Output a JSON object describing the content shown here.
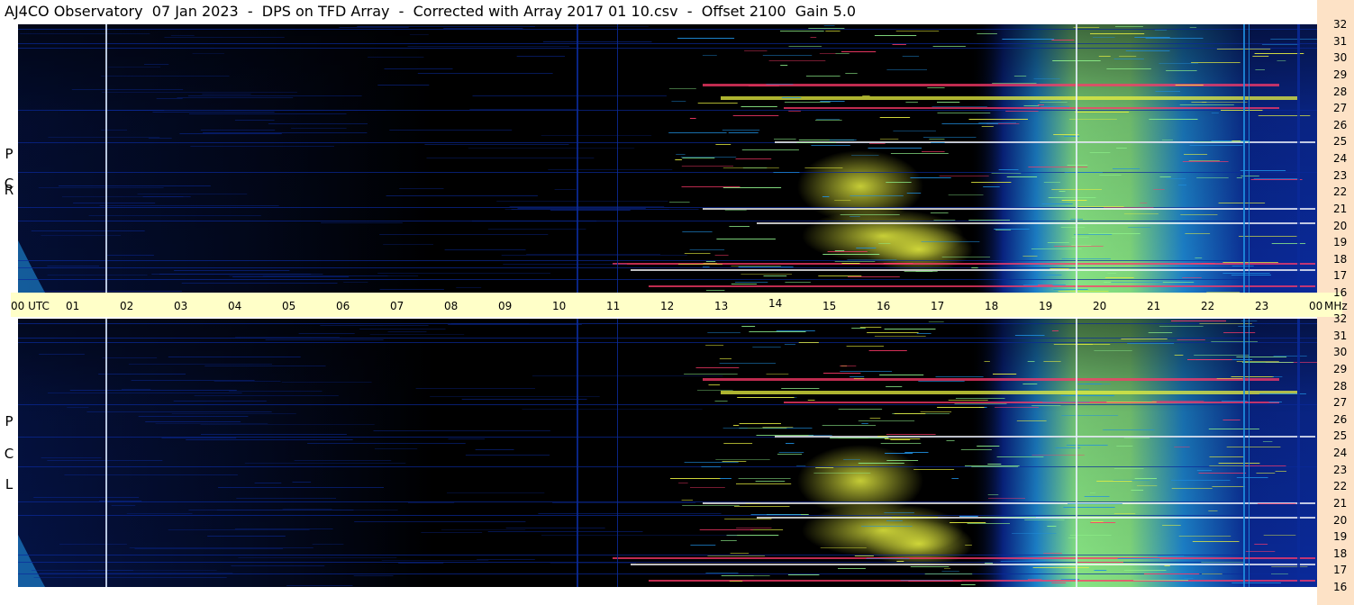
{
  "title": "AJ4CO Observatory  07 Jan 2023  -  DPS on TFD Array  -  Corrected with Array 2017 01 10.csv  -  Offset 2100  Gain 5.0",
  "chart_data": {
    "type": "heatmap",
    "title": "AJ4CO Observatory  07 Jan 2023  -  DPS on TFD Array  -  Corrected with Array 2017 01 10.csv  -  Offset 2100  Gain 5.0",
    "x_axis": {
      "unit_label": "UTC",
      "range": [
        0,
        24
      ],
      "tick_labels": [
        "00 UTC",
        "01",
        "02",
        "03",
        "04",
        "05",
        "06",
        "07",
        "08",
        "09",
        "10",
        "11",
        "12",
        "13",
        "14",
        "15",
        "16",
        "17",
        "18",
        "19",
        "20",
        "21",
        "22",
        "23",
        "00"
      ]
    },
    "y_axis": {
      "unit_label": "MHz",
      "range": [
        16,
        32
      ],
      "tick_labels": [
        "32",
        "31",
        "30",
        "29",
        "28",
        "27",
        "26",
        "25",
        "24",
        "23",
        "22",
        "21",
        "20",
        "19",
        "18",
        "17",
        "16"
      ]
    },
    "panels": [
      {
        "name": "RCP",
        "letters": [
          "P",
          "C",
          "R"
        ]
      },
      {
        "name": "LCP",
        "letters": [
          "P",
          "C",
          "L"
        ]
      }
    ],
    "grid": false,
    "colors": {
      "night": "#000000",
      "low": "#0a2a9a",
      "mid": "#1f8fe0",
      "high": "#8ef08a",
      "peak": "#e8f040",
      "rfi": "#ff3a6a"
    }
  }
}
